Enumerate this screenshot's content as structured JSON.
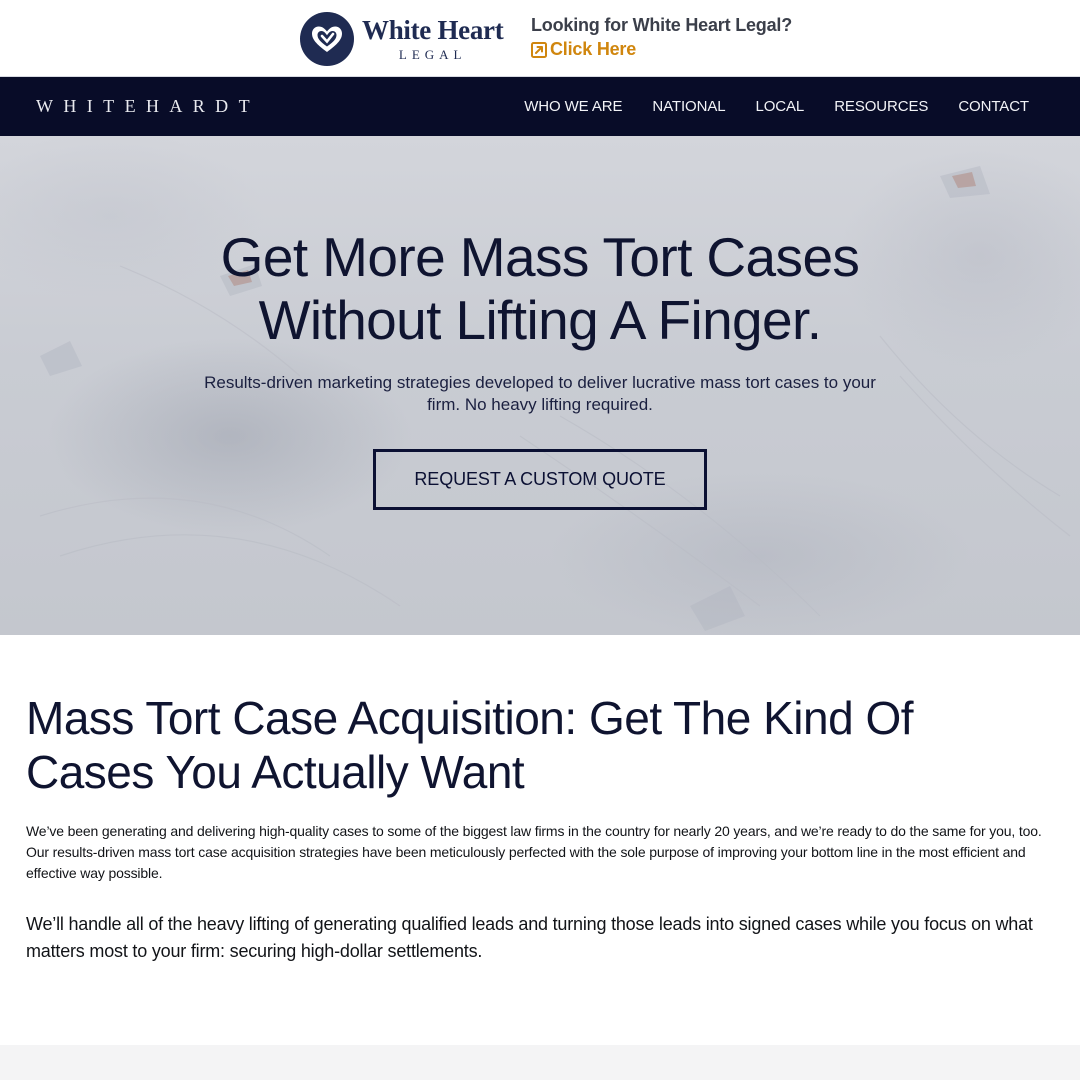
{
  "promo": {
    "logo_main": "White Heart",
    "logo_sub": "LEGAL",
    "question": "Looking for White Heart Legal?",
    "link_label": "Click Here",
    "link_icon": "external-link-icon",
    "logo_icon": "heart-icon"
  },
  "nav": {
    "brand": "WHITEHARDT",
    "links": [
      "WHO WE ARE",
      "NATIONAL",
      "LOCAL",
      "RESOURCES",
      "CONTACT"
    ]
  },
  "hero": {
    "title_line1": "Get More Mass Tort Cases",
    "title_line2": "Without Lifting A Finger.",
    "subtitle": "Results-driven marketing strategies developed to deliver lucrative mass tort cases to your firm. No heavy lifting required.",
    "cta": "REQUEST A CUSTOM QUOTE"
  },
  "intro": {
    "heading": "Mass Tort Case Acquisition: Get The Kind Of Cases You Actually Want",
    "paragraph": "We’ve been generating and delivering high-quality cases to some of the biggest law firms in the country for nearly 20 years, and we’re ready to do the same for you, too. Our results-driven mass tort case acquisition strategies have been meticulously perfected with the sole purpose of improving your bottom line in the most efficient and effective way possible.",
    "lead": "We’ll handle all of the heavy lifting of generating qualified leads and turning those leads into signed cases while you focus on what matters most to your firm: securing high-dollar settlements."
  },
  "colors": {
    "nav_bg": "#080c28",
    "accent_orange": "#d0860e",
    "navy_text": "#0f1430",
    "logo_navy": "#1f2b52"
  }
}
